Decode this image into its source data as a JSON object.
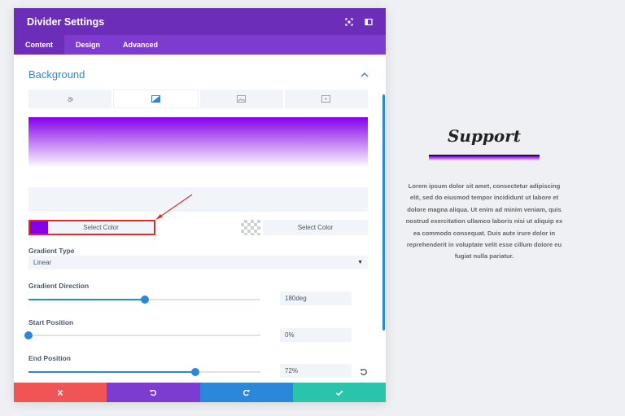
{
  "modal": {
    "title": "Divider Settings",
    "header_icons": [
      "expand-icon",
      "sidebar-toggle-icon"
    ],
    "tabs": [
      {
        "label": "Content",
        "active": true
      },
      {
        "label": "Design",
        "active": false
      },
      {
        "label": "Advanced",
        "active": false
      }
    ]
  },
  "background": {
    "section_title": "Background",
    "type_tabs": [
      {
        "icon": "no-background-icon",
        "active": false
      },
      {
        "icon": "gradient-icon",
        "active": true
      },
      {
        "icon": "image-icon",
        "active": false
      },
      {
        "icon": "video-icon",
        "active": false
      }
    ],
    "gradient": {
      "start_color": "#8300e9",
      "end_color": "#ffffff",
      "start_color_label": "Select Color",
      "end_color_label": "Select Color"
    },
    "gradient_type": {
      "label": "Gradient Type",
      "value": "Linear"
    },
    "gradient_direction": {
      "label": "Gradient Direction",
      "value": "180deg",
      "fraction": 0.5
    },
    "start_position": {
      "label": "Start Position",
      "value": "0%",
      "fraction": 0.0
    },
    "end_position": {
      "label": "End Position",
      "value": "72%",
      "fraction": 0.72
    }
  },
  "actions": {
    "items": [
      {
        "name": "discard",
        "icon": "close-icon",
        "color": "#ef5555"
      },
      {
        "name": "undo",
        "icon": "undo-icon",
        "color": "#7e3bd0"
      },
      {
        "name": "redo",
        "icon": "redo-icon",
        "color": "#2b87da"
      },
      {
        "name": "save",
        "icon": "check-icon",
        "color": "#29c4a9"
      }
    ]
  },
  "preview_card": {
    "title": "Support",
    "body": "Lorem ipsum dolor sit amet, consectetur adipiscing elit, sed do eiusmod tempor incididunt ut labore et dolore magna aliqua. Ut enim ad minim veniam, quis nostrud exercitation ullamco laboris nisi ut aliquip ex ea commodo consequat. Duis aute irure dolor in reprehenderit in voluptate velit esse cillum dolore eu fugiat nulla pariatur."
  },
  "colors": {
    "header": "#6c2eb9",
    "tabs_bar": "#7e3bd0",
    "accent": "#2b87da",
    "highlight_border": "#e02b27"
  }
}
